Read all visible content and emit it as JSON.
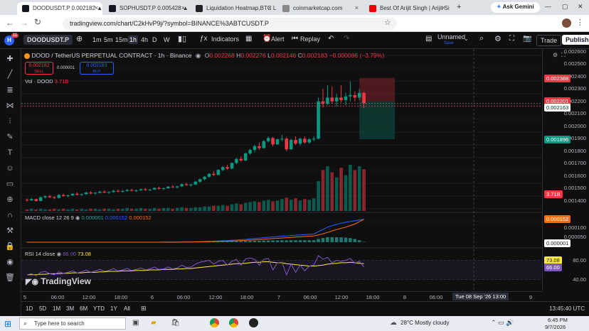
{
  "browser": {
    "tabs": [
      {
        "label": "DOODUSDT.P 0.002182 ▲ +1",
        "fav": "#131722",
        "active": true
      },
      {
        "label": "SOPHUSDT.P 0.005428 ▲ +2",
        "fav": "#131722",
        "active": false
      },
      {
        "label": "Liquidation Heatmap,BTC Liq",
        "fav": "#222",
        "active": false
      },
      {
        "label": "coinmarketcap.com",
        "fav": "#888",
        "active": false
      },
      {
        "label": "Best Of Arijit Singh | Arijit Sin",
        "fav": "#e00",
        "active": false
      }
    ],
    "new_tab": "+",
    "ask_gemini": "Ask Gemini",
    "url": "tradingview.com/chart/C2kHvP9j/?symbol=BINANCE%3ABTCUSDT.P"
  },
  "toolbar": {
    "symbol": "DOODUSDT.P",
    "intervals": [
      "1m",
      "5m",
      "15m",
      "1h",
      "4h",
      "D",
      "W"
    ],
    "indicators": "Indicators",
    "alert": "Alert",
    "replay": "Replay",
    "layout_name": "Unnamed",
    "layout_sub": "Save",
    "trade": "Trade",
    "publish": "Publish",
    "notif_count": "11"
  },
  "legend": {
    "title": "DOOD / TetherUS PERPETUAL CONTRACT · 1h · Binance",
    "o_label": "O",
    "o": "0.002268",
    "h_label": "H",
    "h": "0.002276",
    "l_label": "L",
    "l": "0.002146",
    "c_label": "C",
    "c": "0.002183",
    "chg": "−0.000086 (−3.79%)",
    "sell_price": "0.002182",
    "sell_label": "SELL",
    "spread": "0.000001",
    "buy_price": "0.002183",
    "buy_label": "BUY",
    "vol_label": "Vol · DOOD",
    "vol_value": "3.71B"
  },
  "macd": {
    "label": "MACD close 12 26 9",
    "v1": "0.000001",
    "v2": "0.000152",
    "v3": "0.000152"
  },
  "rsi": {
    "label": "RSI 14 close",
    "v1": "66.00",
    "v2": "73.08"
  },
  "price_axis": {
    "ticks": [
      "0.002600",
      "0.002500",
      "0.002400",
      "0.002300",
      "0.002200",
      "0.002100",
      "0.002000",
      "0.001900",
      "0.001800",
      "0.001700",
      "0.001600",
      "0.001500",
      "0.001400"
    ],
    "badges": {
      "target": "0.002388",
      "entry": "0.002201",
      "current": "0.002163",
      "stop": "0.001896",
      "vol": "3.71B",
      "macd1": "0.000152",
      "macd2": "0.000001",
      "macd_ticks": [
        "0.000100",
        "0.000050"
      ],
      "rsi1": "73.08",
      "rsi2": "66.00",
      "rsi_ticks": [
        "80.00",
        "40.00"
      ]
    }
  },
  "time_axis": {
    "labels": [
      "5",
      "06:00",
      "12:00",
      "18:00",
      "6",
      "06:00",
      "12:00",
      "18:00",
      "7",
      "06:00",
      "12:00",
      "18:00",
      "8",
      "06:00",
      "12:00",
      "9"
    ],
    "crosshair": "Tue 08 Sep '26  13:00"
  },
  "watermark": "TradingView",
  "bottom": {
    "ranges": [
      "1D",
      "5D",
      "1M",
      "3M",
      "6M",
      "YTD",
      "1Y",
      "All"
    ],
    "clock": "13:45:40 UTC"
  },
  "taskbar": {
    "search": "Type here to search",
    "weather": "28°C  Mostly cloudy",
    "time": "6:45 PM",
    "date": "9/7/2026"
  },
  "colors": {
    "up": "#089981",
    "down": "#f23645",
    "accent": "#2962ff"
  },
  "chart_data": {
    "type": "candlestick",
    "candles": [
      [
        0.00141,
        0.00142,
        0.001395,
        0.001405
      ],
      [
        0.001405,
        0.001425,
        0.0014,
        0.001415
      ],
      [
        0.001415,
        0.00142,
        0.001395,
        0.0014
      ],
      [
        0.0014,
        0.001435,
        0.001398,
        0.00143
      ],
      [
        0.00143,
        0.001445,
        0.00142,
        0.001438
      ],
      [
        0.001438,
        0.00145,
        0.001425,
        0.00143
      ],
      [
        0.00143,
        0.00144,
        0.001415,
        0.001425
      ],
      [
        0.001425,
        0.001455,
        0.00142,
        0.001448
      ],
      [
        0.001448,
        0.00146,
        0.001435,
        0.00144
      ],
      [
        0.00144,
        0.00145,
        0.00143,
        0.001445
      ],
      [
        0.001445,
        0.001465,
        0.00144,
        0.001458
      ],
      [
        0.001458,
        0.00147,
        0.001445,
        0.00145
      ],
      [
        0.00145,
        0.00146,
        0.00144,
        0.001455
      ],
      [
        0.001455,
        0.001475,
        0.00145,
        0.001468
      ],
      [
        0.001468,
        0.00148,
        0.001455,
        0.00146
      ],
      [
        0.00146,
        0.001472,
        0.00145,
        0.001466
      ],
      [
        0.001466,
        0.001482,
        0.00146,
        0.001475
      ],
      [
        0.001475,
        0.001485,
        0.001462,
        0.001468
      ],
      [
        0.001468,
        0.001478,
        0.001458,
        0.001472
      ],
      [
        0.001472,
        0.00149,
        0.001468,
        0.001482
      ],
      [
        0.001482,
        0.001492,
        0.00147,
        0.001476
      ],
      [
        0.001476,
        0.001488,
        0.001468,
        0.00148
      ],
      [
        0.00148,
        0.001495,
        0.001475,
        0.001488
      ],
      [
        0.001488,
        0.001498,
        0.001478,
        0.001482
      ],
      [
        0.001482,
        0.001492,
        0.001472,
        0.001486
      ],
      [
        0.001486,
        0.0015,
        0.00148,
        0.001494
      ],
      [
        0.001494,
        0.001505,
        0.001482,
        0.001488
      ],
      [
        0.001488,
        0.001498,
        0.001478,
        0.001492
      ],
      [
        0.001492,
        0.00151,
        0.001488,
        0.001505
      ],
      [
        0.001505,
        0.001515,
        0.001492,
        0.001498
      ],
      [
        0.001498,
        0.001508,
        0.001488,
        0.001502
      ],
      [
        0.001502,
        0.00152,
        0.001498,
        0.001515
      ],
      [
        0.001515,
        0.001528,
        0.001505,
        0.00151
      ],
      [
        0.00151,
        0.001522,
        0.0015,
        0.001518
      ],
      [
        0.001518,
        0.00154,
        0.001512,
        0.001535
      ],
      [
        0.001535,
        0.001548,
        0.001522,
        0.001528
      ],
      [
        0.001528,
        0.001538,
        0.001515,
        0.001532
      ],
      [
        0.001532,
        0.00156,
        0.001528,
        0.001555
      ],
      [
        0.001555,
        0.00158,
        0.001545,
        0.001575
      ],
      [
        0.001575,
        0.0016,
        0.001565,
        0.001595
      ],
      [
        0.001595,
        0.001625,
        0.001585,
        0.001618
      ],
      [
        0.001618,
        0.00164,
        0.0016,
        0.00161
      ],
      [
        0.00161,
        0.001655,
        0.001605,
        0.00165
      ],
      [
        0.00165,
        0.00168,
        0.00164,
        0.001672
      ],
      [
        0.001672,
        0.00169,
        0.00165,
        0.00166
      ],
      [
        0.00166,
        0.00171,
        0.001655,
        0.001705
      ],
      [
        0.001705,
        0.001745,
        0.001695,
        0.001738
      ],
      [
        0.001738,
        0.00176,
        0.001715,
        0.001725
      ],
      [
        0.001725,
        0.00179,
        0.00172,
        0.001782
      ],
      [
        0.001782,
        0.00182,
        0.00177,
        0.00181
      ],
      [
        0.00181,
        0.00185,
        0.00179,
        0.00184
      ],
      [
        0.00184,
        0.00187,
        0.00181,
        0.001825
      ],
      [
        0.001825,
        0.00189,
        0.00182,
        0.00188
      ],
      [
        0.00188,
        0.00192,
        0.00187,
        0.001905
      ],
      [
        0.001905,
        0.001915,
        0.00184,
        0.001855
      ],
      [
        0.001855,
        0.0019,
        0.00185,
        0.001895
      ],
      [
        0.001895,
        0.00193,
        0.00188,
        0.0019
      ],
      [
        0.0019,
        0.001915,
        0.0018,
        0.001815
      ],
      [
        0.001815,
        0.0019,
        0.00181,
        0.00189
      ],
      [
        0.00189,
        0.00192,
        0.00185,
        0.00186
      ],
      [
        0.00186,
        0.00191,
        0.001845,
        0.0019
      ],
      [
        0.0019,
        0.00192,
        0.00186,
        0.00187
      ],
      [
        0.00187,
        0.001905,
        0.00186,
        0.001895
      ],
      [
        0.001895,
        0.00192,
        0.00188,
        0.0019
      ],
      [
        0.0019,
        0.00223,
        0.001895,
        0.0022
      ],
      [
        0.0022,
        0.0023,
        0.00215,
        0.00218
      ],
      [
        0.00218,
        0.00233,
        0.00217,
        0.00223
      ],
      [
        0.00223,
        0.00232,
        0.00218,
        0.0022
      ],
      [
        0.0022,
        0.00226,
        0.00216,
        0.00223
      ],
      [
        0.00223,
        0.00233,
        0.00219,
        0.00221
      ],
      [
        0.00221,
        0.00227,
        0.00217,
        0.00224
      ],
      [
        0.00224,
        0.00236,
        0.0022,
        0.00225
      ],
      [
        0.00225,
        0.00228,
        0.0022,
        0.00223
      ],
      [
        0.00223,
        0.0023,
        0.00221,
        0.002268
      ],
      [
        0.002268,
        0.002276,
        0.002146,
        0.002183
      ]
    ],
    "ylim": [
      0.00132,
      0.00262
    ],
    "position": {
      "target": 0.002388,
      "entry": 0.002201,
      "stop": 0.001896
    },
    "volume": [
      2,
      3,
      2,
      3,
      2,
      2,
      3,
      2,
      3,
      2,
      3,
      2,
      3,
      2,
      3,
      3,
      2,
      3,
      3,
      2,
      3,
      3,
      4,
      3,
      3,
      4,
      3,
      3,
      4,
      3,
      4,
      4,
      3,
      4,
      5,
      4,
      4,
      5,
      5,
      6,
      6,
      7,
      7,
      8,
      7,
      9,
      10,
      9,
      11,
      12,
      13,
      12,
      14,
      15,
      13,
      14,
      16,
      18,
      15,
      17,
      14,
      16,
      15,
      17,
      40,
      55,
      60,
      52,
      45,
      58,
      48,
      62,
      55,
      60,
      56
    ],
    "macd_line": [
      0,
      0,
      0,
      0,
      0,
      0,
      0,
      0,
      0,
      0,
      0,
      0,
      0,
      0,
      0,
      0,
      0,
      0,
      0,
      0,
      0,
      0,
      0,
      0,
      0,
      0,
      0,
      0,
      0,
      0,
      1,
      1,
      1,
      1,
      2,
      2,
      2,
      3,
      4,
      5,
      6,
      7,
      8,
      10,
      11,
      13,
      15,
      17,
      19,
      22,
      25,
      27,
      30,
      33,
      35,
      37,
      40,
      41,
      44,
      46,
      48,
      50,
      52,
      54,
      70,
      85,
      100,
      110,
      118,
      126,
      132,
      138,
      142,
      148,
      152
    ],
    "signal_line": [
      0,
      0,
      0,
      0,
      0,
      0,
      0,
      0,
      0,
      0,
      0,
      0,
      0,
      0,
      0,
      0,
      0,
      0,
      0,
      0,
      0,
      0,
      0,
      0,
      0,
      0,
      0,
      0,
      0,
      0,
      0,
      0,
      0,
      0,
      1,
      1,
      1,
      2,
      2,
      3,
      4,
      4,
      5,
      6,
      7,
      8,
      9,
      11,
      12,
      14,
      16,
      18,
      20,
      22,
      24,
      26,
      28,
      30,
      32,
      34,
      36,
      38,
      40,
      42,
      48,
      56,
      65,
      75,
      84,
      92,
      100,
      110,
      120,
      136,
      152
    ],
    "rsi": [
      50,
      52,
      48,
      55,
      57,
      52,
      50,
      56,
      53,
      55,
      58,
      54,
      56,
      60,
      55,
      58,
      61,
      57,
      59,
      63,
      58,
      60,
      63,
      59,
      61,
      64,
      60,
      62,
      66,
      61,
      62,
      66,
      62,
      64,
      70,
      65,
      66,
      72,
      76,
      78,
      80,
      72,
      78,
      80,
      70,
      78,
      82,
      70,
      83,
      85,
      82,
      70,
      82,
      84,
      60,
      75,
      76,
      50,
      72,
      55,
      70,
      58,
      68,
      70,
      90,
      82,
      86,
      75,
      80,
      78,
      80,
      84,
      74,
      78,
      66
    ],
    "rsi_ma": [
      50,
      50,
      50,
      51,
      51,
      52,
      52,
      52,
      53,
      53,
      54,
      54,
      54,
      55,
      55,
      55,
      56,
      56,
      57,
      57,
      57,
      58,
      58,
      58,
      59,
      59,
      59,
      60,
      60,
      60,
      61,
      61,
      61,
      62,
      62,
      63,
      63,
      64,
      65,
      66,
      67,
      68,
      69,
      70,
      71,
      72,
      73,
      73,
      74,
      75,
      76,
      76,
      77,
      77,
      76,
      75,
      75,
      73,
      72,
      71,
      70,
      69,
      68,
      68,
      69,
      70,
      72,
      73,
      74,
      75,
      75,
      76,
      75,
      74,
      73
    ],
    "rsi_band": [
      40,
      80
    ]
  }
}
